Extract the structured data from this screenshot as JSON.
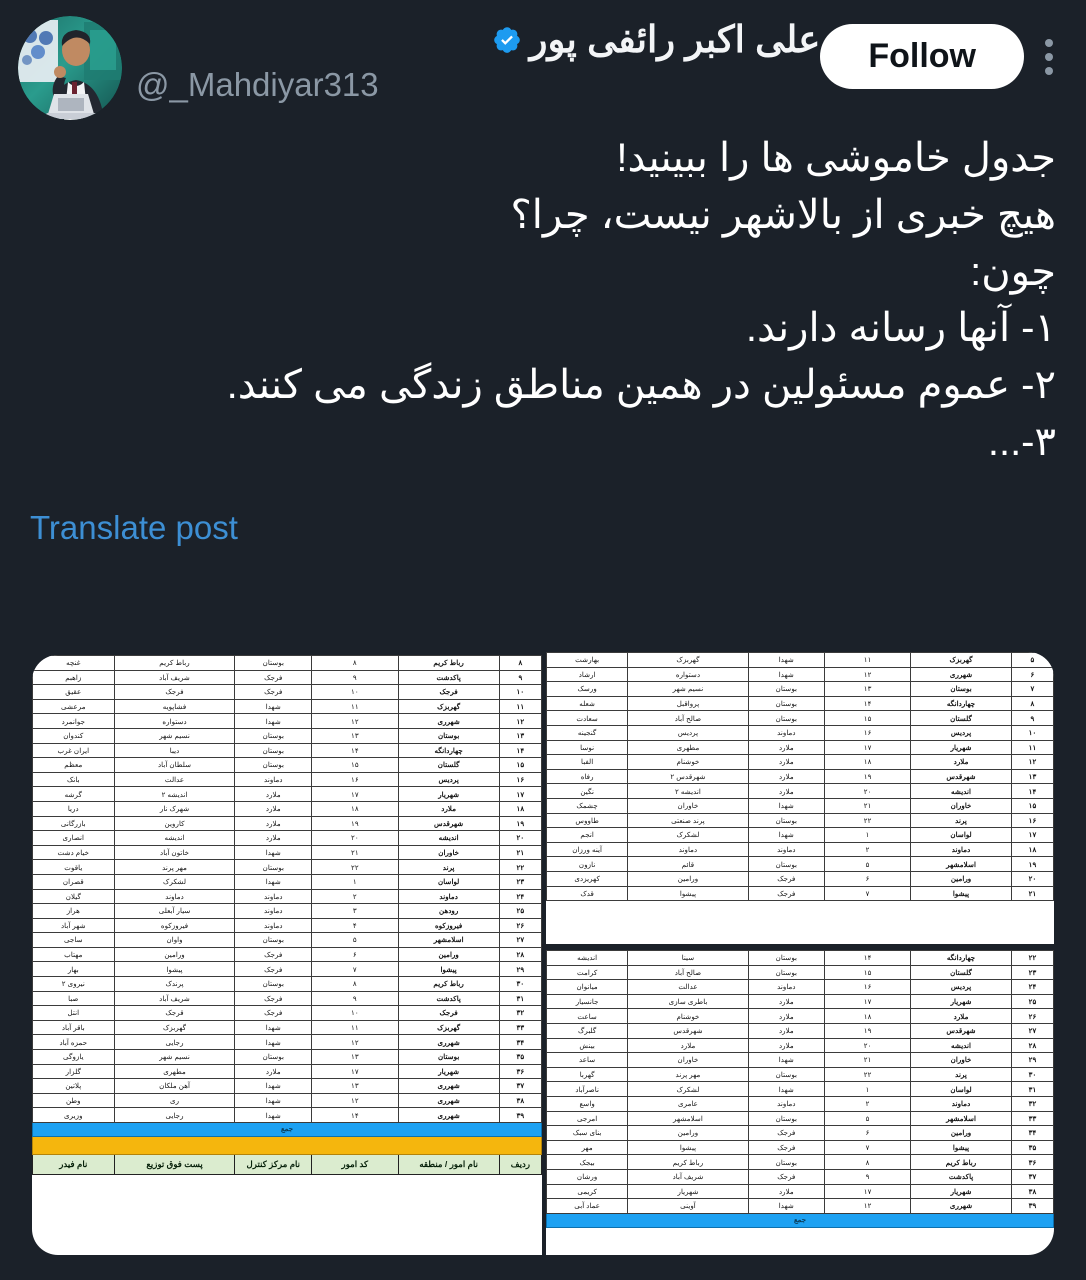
{
  "account": {
    "display_name": "علی اکبر رائفی پور",
    "handle": "@_Mahdiyar313",
    "verified": true,
    "avatar_alt": "avatar-photo"
  },
  "header": {
    "follow_label": "Follow",
    "more_label": "More"
  },
  "tweet": {
    "lines": [
      "جدول خاموشی ها را ببینید!",
      "هیچ خبری از بالاشهر نیست، چرا؟",
      "چون:",
      "۱- آنها رسانه دارند.",
      "۲- عموم مسئولین در همین مناطق زندگی می کنند.",
      "۳-..."
    ],
    "translate_label": "Translate post"
  },
  "colors": {
    "background": "#1b2129",
    "link": "#3d8fd4",
    "verified_blue": "#1d9bf0",
    "follow_bg": "#ffffff",
    "muted_text": "#8b98a5",
    "header_row": "#dbeccf",
    "summary_blue": "#1da1f2",
    "summary_orange": "#f5b60d"
  },
  "tables": {
    "columns": [
      "ردیف",
      "نام امور / منطقه",
      "کد امور",
      "نام مرکز کنترل",
      "پست فوق توزیع",
      "نام فیدر"
    ],
    "summary_blue_label": "جمع",
    "left": {
      "rows": [
        [
          "۸",
          "رباط کریم",
          "۸",
          "بوستان",
          "رباط کریم",
          "غنچه"
        ],
        [
          "۹",
          "پاکدشت",
          "۹",
          "فرجک",
          "شریف آباد",
          "زاهبم"
        ],
        [
          "۱۰",
          "فرجک",
          "۱۰",
          "فرجک",
          "فرجک",
          "عقیق"
        ],
        [
          "۱۱",
          "گهربزک",
          "۱۱",
          "شهدا",
          "فشاپویه",
          "مرعشی"
        ],
        [
          "۱۲",
          "شهرری",
          "۱۲",
          "شهدا",
          "دستواره",
          "جوانمرد"
        ],
        [
          "۱۳",
          "بوستان",
          "۱۳",
          "بوستان",
          "نسیم شهر",
          "کندوان"
        ],
        [
          "۱۴",
          "چهاردانگه",
          "۱۴",
          "بوستان",
          "دیبا",
          "ایران غرب"
        ],
        [
          "۱۵",
          "گلستان",
          "۱۵",
          "بوستان",
          "سلطان آباد",
          "معظم"
        ],
        [
          "۱۶",
          "پردیس",
          "۱۶",
          "دماوند",
          "عدالت",
          "بانک"
        ],
        [
          "۱۷",
          "شهریار",
          "۱۷",
          "ملارد",
          "اندیشه ۲",
          "گرشه"
        ],
        [
          "۱۸",
          "ملارد",
          "۱۸",
          "ملارد",
          "شهرک نار",
          "دریا"
        ],
        [
          "۱۹",
          "شهرقدس",
          "۱۹",
          "ملارد",
          "کاروین",
          "بازرگانی"
        ],
        [
          "۲۰",
          "اندیشه",
          "۲۰",
          "ملارد",
          "اندیشه",
          "انصاری"
        ],
        [
          "۲۱",
          "خاوران",
          "۲۱",
          "شهدا",
          "خاتون آباد",
          "خیام دشت"
        ],
        [
          "۲۲",
          "پرند",
          "۲۲",
          "بوستان",
          "مهر پرند",
          "یاقوت"
        ],
        [
          "۲۳",
          "لواسان",
          "۱",
          "شهدا",
          "لشکرک",
          "قصران"
        ],
        [
          "۲۴",
          "دماوند",
          "۲",
          "دماوند",
          "دماوند",
          "گیلان"
        ],
        [
          "۲۵",
          "رودهن",
          "۳",
          "دماوند",
          "سیار آبعلی",
          "هراز"
        ],
        [
          "۲۶",
          "فیروزکوه",
          "۴",
          "دماوند",
          "فیروزکوه",
          "شهر آباد"
        ],
        [
          "۲۷",
          "اسلامشهر",
          "۵",
          "بوستان",
          "واوان",
          "ساجی"
        ],
        [
          "۲۸",
          "ورامین",
          "۶",
          "فرجک",
          "ورامین",
          "مهتاب"
        ],
        [
          "۲۹",
          "پیشوا",
          "۷",
          "فرجک",
          "پیشوا",
          "بهار"
        ],
        [
          "۳۰",
          "رباط کریم",
          "۸",
          "بوستان",
          "پرندک",
          "نیروی ۲"
        ],
        [
          "۳۱",
          "پاکدشت",
          "۹",
          "فرجک",
          "شریف آباد",
          "صبا"
        ],
        [
          "۳۲",
          "فرجک",
          "۱۰",
          "فرجک",
          "قرجک",
          "انتل"
        ],
        [
          "۳۳",
          "گهربزک",
          "۱۱",
          "شهدا",
          "گهربزک",
          "باقر آباد"
        ],
        [
          "۳۴",
          "شهرری",
          "۱۲",
          "شهدا",
          "رجایی",
          "حمزه آباد"
        ],
        [
          "۳۵",
          "بوستان",
          "۱۳",
          "بوستان",
          "نسیم شهر",
          "یازوگی"
        ],
        [
          "۳۶",
          "شهریار",
          "۱۷",
          "ملارد",
          "مطهری",
          "گلزار"
        ],
        [
          "۳۷",
          "شهرری",
          "۱۳",
          "شهدا",
          "آهن ملکان",
          "پلاتین"
        ],
        [
          "۳۸",
          "شهرری",
          "۱۲",
          "شهدا",
          "ری",
          "وطن"
        ],
        [
          "۳۹",
          "شهرری",
          "۱۴",
          "شهدا",
          "رجایی",
          "وزیری"
        ]
      ]
    },
    "right_top": {
      "rows": [
        [
          "۵",
          "گهربزک",
          "۱۱",
          "شهدا",
          "گهربزک",
          "بهارشت"
        ],
        [
          "۶",
          "شهرری",
          "۱۲",
          "شهدا",
          "دستواره",
          "ارشاد"
        ],
        [
          "۷",
          "بوستان",
          "۱۳",
          "بوستان",
          "نسیم شهر",
          "ورسک"
        ],
        [
          "۸",
          "چهاردانگه",
          "۱۴",
          "بوستان",
          "پرواقبل",
          "شعله"
        ],
        [
          "۹",
          "گلستان",
          "۱۵",
          "بوستان",
          "صالح آباد",
          "سعادت"
        ],
        [
          "۱۰",
          "پردیس",
          "۱۶",
          "دماوند",
          "پردیس",
          "گنجینه"
        ],
        [
          "۱۱",
          "شهریار",
          "۱۷",
          "ملارد",
          "مطهری",
          "نوسا"
        ],
        [
          "۱۲",
          "ملارد",
          "۱۸",
          "ملارد",
          "خوشنام",
          "الفبا"
        ],
        [
          "۱۳",
          "شهرقدس",
          "۱۹",
          "ملارد",
          "شهرقدس ۲",
          "رفاه"
        ],
        [
          "۱۴",
          "اندیشه",
          "۲۰",
          "ملارد",
          "اندیشه ۲",
          "نگین"
        ],
        [
          "۱۵",
          "خاوران",
          "۲۱",
          "شهدا",
          "خاوران",
          "چشمک"
        ],
        [
          "۱۶",
          "پرند",
          "۲۲",
          "بوستان",
          "پرند صنعتی",
          "طاووس"
        ],
        [
          "۱۷",
          "لواسان",
          "۱",
          "شهدا",
          "لشکرک",
          "انجم"
        ],
        [
          "۱۸",
          "دماوند",
          "۲",
          "دماوند",
          "دماوند",
          "آینه ورزان"
        ],
        [
          "۱۹",
          "اسلامشهر",
          "۵",
          "بوستان",
          "قائم",
          "نازون"
        ],
        [
          "۲۰",
          "ورامین",
          "۶",
          "فرجک",
          "ورامین",
          "کهریزدی"
        ],
        [
          "۲۱",
          "پیشوا",
          "۷",
          "فرجک",
          "پیشوا",
          "قدک"
        ]
      ]
    },
    "right_bottom": {
      "rows": [
        [
          "۲۲",
          "چهاردانگه",
          "۱۴",
          "بوستان",
          "سینا",
          "اندیشه"
        ],
        [
          "۲۳",
          "گلستان",
          "۱۵",
          "بوستان",
          "صالح آباد",
          "کرامت"
        ],
        [
          "۲۴",
          "پردیس",
          "۱۶",
          "دماوند",
          "عدالت",
          "میانوان"
        ],
        [
          "۲۵",
          "شهریار",
          "۱۷",
          "ملارد",
          "باطری سازی",
          "جانسیار"
        ],
        [
          "۲۶",
          "ملارد",
          "۱۸",
          "ملارد",
          "خوشنام",
          "ساعت"
        ],
        [
          "۲۷",
          "شهرقدس",
          "۱۹",
          "ملارد",
          "شهرقدس",
          "گلبرگ"
        ],
        [
          "۲۸",
          "اندیشه",
          "۲۰",
          "ملارد",
          "ملارد",
          "بینش"
        ],
        [
          "۲۹",
          "خاوران",
          "۲۱",
          "شهدا",
          "خاوران",
          "ساعد"
        ],
        [
          "۳۰",
          "پرند",
          "۲۲",
          "بوستان",
          "مهر پرند",
          "گهربا"
        ],
        [
          "۳۱",
          "لواسان",
          "۱",
          "شهدا",
          "لشکرک",
          "ناصرآباد"
        ],
        [
          "۳۲",
          "دماوند",
          "۲",
          "دماوند",
          "عامری",
          "واسع"
        ],
        [
          "۳۳",
          "اسلامشهر",
          "۵",
          "بوستان",
          "اسلامشهر",
          "امرجی"
        ],
        [
          "۳۴",
          "ورامین",
          "۶",
          "فرجک",
          "ورامین",
          "بنای سبک"
        ],
        [
          "۳۵",
          "پیشوا",
          "۷",
          "فرجک",
          "پیشوا",
          "مهر"
        ],
        [
          "۳۶",
          "رباط کریم",
          "۸",
          "بوستان",
          "رباط کریم",
          "بیجک"
        ],
        [
          "۳۷",
          "پاکدشت",
          "۹",
          "فرجک",
          "شریف آباد",
          "ورشان"
        ],
        [
          "۳۸",
          "شهریار",
          "۱۷",
          "ملارد",
          "شهریار",
          "کریمی"
        ],
        [
          "۳۹",
          "شهرری",
          "۱۲",
          "شهدا",
          "آوینی",
          "عماد آبی"
        ]
      ]
    }
  }
}
